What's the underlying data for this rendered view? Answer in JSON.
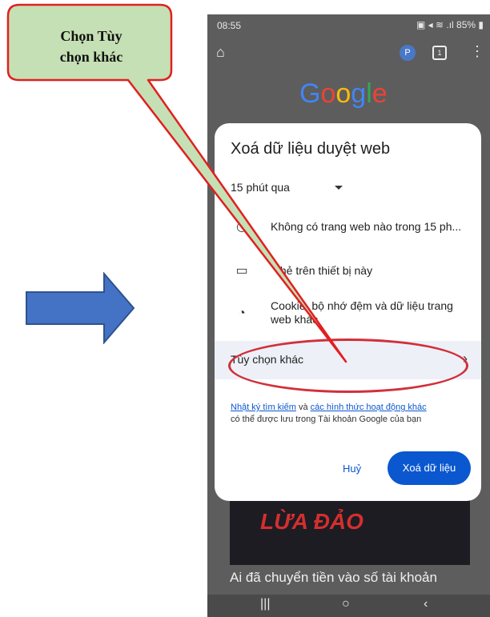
{
  "callout": {
    "text_line1": "Chọn Tùy",
    "text_line2": "chọn khác"
  },
  "status_bar": {
    "time": "08:55",
    "battery": "85%"
  },
  "browser": {
    "profile_initial": "P",
    "tab_count": "1"
  },
  "google_logo": {
    "letters": [
      "G",
      "o",
      "o",
      "g",
      "l",
      "e"
    ],
    "colors": [
      "#4285F4",
      "#EA4335",
      "#FBBC05",
      "#4285F4",
      "#34A853",
      "#EA4335"
    ]
  },
  "dialog": {
    "title": "Xoá dữ liệu duyệt web",
    "time_range": "15 phút qua",
    "rows": [
      {
        "icon": "history-icon",
        "text": "Không có trang web nào trong 15 ph..."
      },
      {
        "icon": "tabs-icon",
        "text": "thẻ trên thiết bị này"
      },
      {
        "icon": "cookie-icon",
        "text": "Cookie, bộ nhớ đệm và dữ liệu trang web khác"
      }
    ],
    "more_options": "Tùy chọn khác",
    "note_link1": "Nhật ký tìm kiếm",
    "note_and": " và ",
    "note_link2": "các hình thức hoạt động khác",
    "note_rest": "có thể được lưu trong Tài khoản Google của bạn",
    "cancel": "Huỷ",
    "delete": "Xoá dữ liệu"
  },
  "background": {
    "article_image_text": "LỪA ĐẢO",
    "article_title": "Ai đã chuyển tiền vào số tài khoản"
  },
  "colors": {
    "accent": "#0b57d0",
    "highlight_red": "#d1303a",
    "arrow_blue": "#4472c4",
    "callout_fill": "#c5e0b4"
  }
}
